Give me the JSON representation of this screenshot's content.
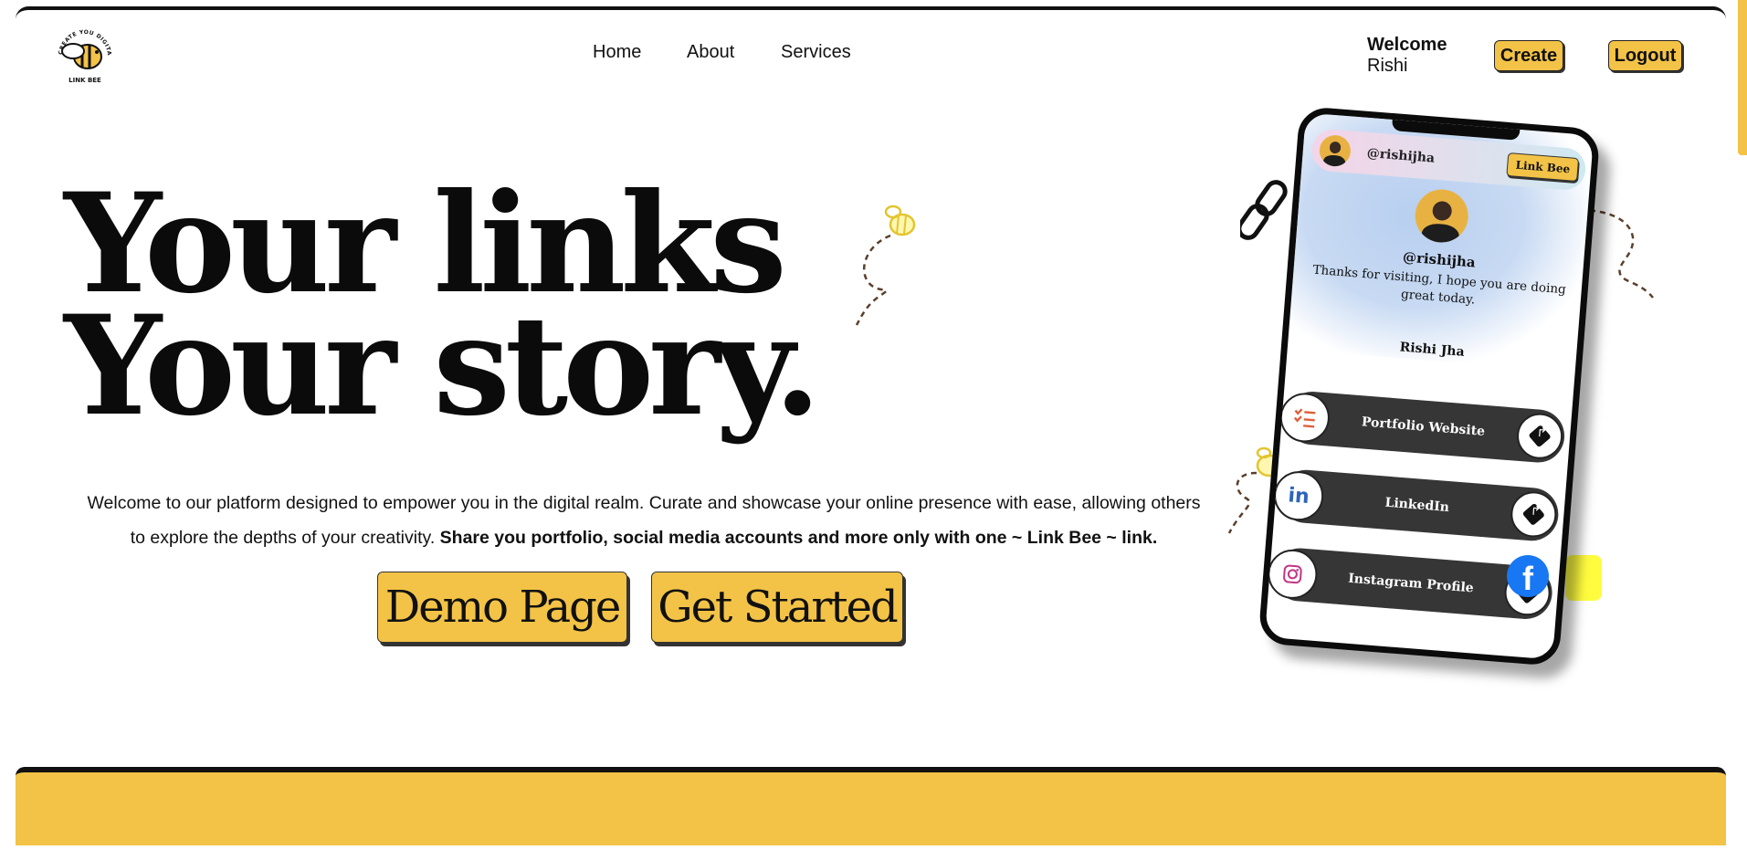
{
  "brand": {
    "logo_text": "LINK BEE",
    "logo_ring_text": "CREATE YOU DIGITAL FOOTPRINT",
    "accent": "#f3c347",
    "dark": "#111111"
  },
  "nav": {
    "items": [
      "Home",
      "About",
      "Services"
    ]
  },
  "user": {
    "welcome": "Welcome",
    "name": "Rishi"
  },
  "actions": {
    "create": "Create",
    "logout": "Logout"
  },
  "hero": {
    "line1": "Your links",
    "line2": "Your story.",
    "intro_plain": "Welcome to our platform designed to empower you in the digital realm. Curate and showcase your online presence with ease, allowing others to explore the depths of your creativity. ",
    "intro_bold": "Share you portfolio, social media accounts and more only with one ~ Link Bee ~ link.",
    "demo_button": "Demo Page",
    "start_button": "Get Started"
  },
  "phone": {
    "top_handle": "@rishijha",
    "badge": "Link Bee",
    "handle": "@rishijha",
    "bio": "Thanks for visiting, I hope you are doing great today.",
    "name": "Rishi Jha",
    "links": [
      {
        "label": "Portfolio Website",
        "icon": "checklist-icon"
      },
      {
        "label": "LinkedIn",
        "icon": "linkedin-icon"
      },
      {
        "label": "Instagram Profile",
        "icon": "instagram-icon"
      }
    ]
  },
  "decor": {
    "facebook_glyph": "f",
    "linkedin_glyph": "in"
  }
}
